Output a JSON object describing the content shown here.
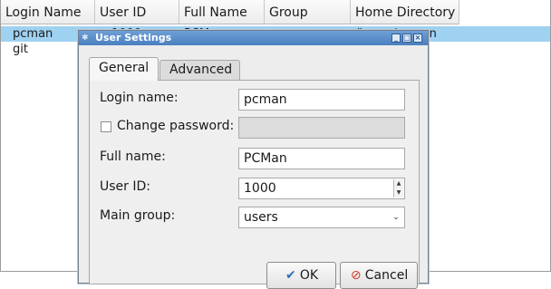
{
  "list": {
    "columns": [
      "Login Name",
      "User ID",
      "Full Name",
      "Group",
      "Home Directory"
    ],
    "rows": [
      {
        "login": "pcman",
        "uid": "1000",
        "fullname": "PCMan",
        "group": "",
        "home": "/home/pcman",
        "selected": true
      },
      {
        "login": "git",
        "uid": "",
        "fullname": "",
        "group": "",
        "home": "",
        "selected": false
      }
    ]
  },
  "dialog": {
    "title": "User Settings",
    "tabs": [
      "General",
      "Advanced"
    ],
    "active_tab": "General",
    "fields": {
      "login_label": "Login name:",
      "login_value": "pcman",
      "change_password_label": "Change password:",
      "change_password_checked": false,
      "password_value": "",
      "fullname_label": "Full name:",
      "fullname_value": "PCMan",
      "uid_label": "User ID:",
      "uid_value": "1000",
      "group_label": "Main group:",
      "group_value": "users"
    },
    "buttons": {
      "ok": "OK",
      "cancel": "Cancel"
    }
  },
  "icons": {
    "title": "dialog-icon",
    "minimize": "minimize-icon",
    "maximize": "maximize-icon",
    "close": "close-icon",
    "ok": "check-icon",
    "cancel": "cancel-icon"
  },
  "colors": {
    "selection": "#9fd1f1",
    "titlebar": "#4a7fc0"
  }
}
